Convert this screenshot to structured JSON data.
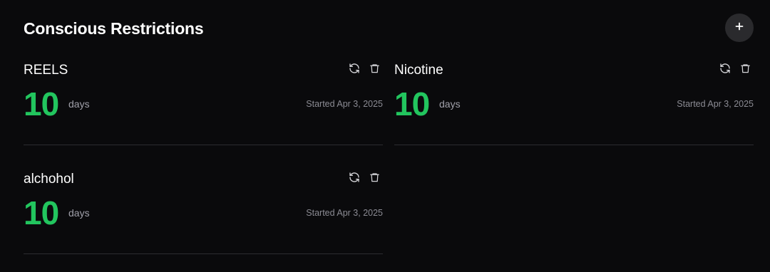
{
  "header": {
    "title": "Conscious Restrictions",
    "add_label": "+"
  },
  "colors": {
    "background": "#0a0a0c",
    "accent_green": "#22c55e",
    "muted_text": "#a1a1aa",
    "button_bg": "#2a2a2d",
    "divider": "#2c2c30"
  },
  "restrictions": [
    {
      "name": "REELS",
      "count": "10",
      "unit": "days",
      "started": "Started Apr 3, 2025",
      "actions": [
        "refresh-icon",
        "trash-icon"
      ]
    },
    {
      "name": "Nicotine",
      "count": "10",
      "unit": "days",
      "started": "Started Apr 3, 2025",
      "actions": [
        "refresh-icon",
        "trash-icon"
      ]
    },
    {
      "name": "alchohol",
      "count": "10",
      "unit": "days",
      "started": "Started Apr 3, 2025",
      "actions": [
        "refresh-icon",
        "trash-icon"
      ]
    }
  ]
}
